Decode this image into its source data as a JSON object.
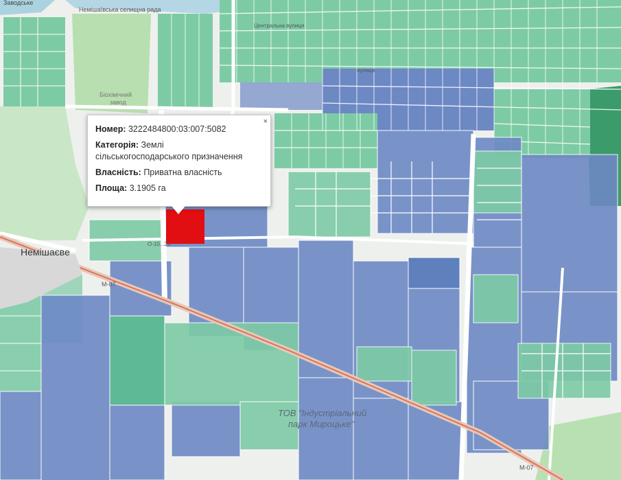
{
  "map": {
    "colors": {
      "background": "#eef0ee",
      "private": "#6d89c4",
      "communal": "#7dcba5",
      "state": "#4f74b8",
      "selected": "#e10e12",
      "road": "#ffffff",
      "highway": "#f0a585"
    },
    "labels": {
      "town": "Немішаєве",
      "industrial_park_line1": "ТОВ \"Індустріальний",
      "industrial_park_line2": "парк Мироцьке\"",
      "road_m07_a": "М-07",
      "road_m07_b": "М-07",
      "road_o10": "О-10...24",
      "settlement_council": "Немішаївська селищна рада",
      "street_1": "Центральна вулиця",
      "street_2": "вулиця",
      "biohimic_1": "Біохімічний",
      "biohimic_2": "завод",
      "zavodske": "Заводське"
    }
  },
  "popup": {
    "number_label": "Номер:",
    "number_value": "3222484800:03:007:5082",
    "category_label": "Категорія:",
    "category_value_1": "Землі",
    "category_value_2": "сільськогосподарського призначення",
    "ownership_label": "Власність:",
    "ownership_value": "Приватна власність",
    "area_label": "Площа:",
    "area_value": "3.1905 га",
    "close": "×"
  }
}
